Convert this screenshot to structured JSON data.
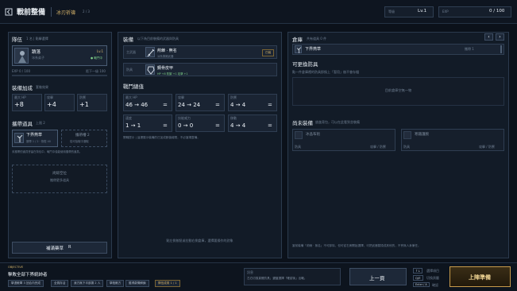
{
  "topbar": {
    "title": "戰前整備",
    "mode": "冰刃祈禱",
    "mode_sub": "2 / 3",
    "level_label": "等級",
    "level_value": "Lv.1",
    "exp_label": "EXP",
    "exp_value": "0 / 100"
  },
  "squad": {
    "title": "隊伍",
    "title_sub": "1 名 | 點擊選擇",
    "member_name": "蹟落",
    "member_class": "冰系弟子",
    "member_level": "Lv.1",
    "member_status": "● 戰鬥中",
    "exp_text": "EXP 0 / 100",
    "exp_next": "距下一級 100",
    "bonus_title": "裝備加成",
    "bonus_sub": "套裝效果",
    "stats": [
      {
        "label": "最大 HP",
        "value": "+8"
      },
      {
        "label": "攻擊",
        "value": "+4"
      },
      {
        "label": "防禦",
        "value": "+1"
      }
    ],
    "carry_title": "攜帶道具",
    "carry_sub": "上限 2",
    "slot1_name": "下界燕草",
    "slot1_meta": "攜帶 1 / 2 · 恢復 40",
    "slot2_name": "攜帶槽 2",
    "slot2_meta": "從可拾取中選取",
    "carry_hint": "未攜帶的道具會留在背包中，戰鬥中僅能使用攜帶的道具。",
    "empty_slot_title": "尚餘空位",
    "empty_slot_sub": "攜帶更多道具",
    "supply_button": "補滿藥草",
    "supply_key": "R"
  },
  "equip": {
    "title": "裝備",
    "title_sub": "以下為目前裝備的武器與防具",
    "weapon_label": "主武器",
    "weapon_name": "荊棘 · 無名",
    "weapon_desc": "冰系專屬武器",
    "weapon_tag": "已裝",
    "armor_label": "防具",
    "armor_name": "鋼骨皮甲",
    "armor_desc": "HP +8   防禦 +1   攻擊 +1",
    "battle_title": "戰鬥總值",
    "battle_stats": [
      {
        "label": "最大 HP",
        "value": "46 → 46"
      },
      {
        "label": "攻擊",
        "value": "24 → 24"
      },
      {
        "label": "防禦",
        "value": "4 → 4"
      },
      {
        "label": "速度",
        "value": "1 → 1"
      },
      {
        "label": "技能威力",
        "value": "0 → 0"
      },
      {
        "label": "移動",
        "value": "4 → 4"
      }
    ],
    "equal_sign": "=",
    "tip": "實戰提示 | 這裡展示裝備的已加成數值總覽，不必當場整備。",
    "footer_hint": "點左側按鈕或拉動右側倉庫，選擇要操作的對象"
  },
  "storage": {
    "title": "倉庫",
    "title_sub": "共有道具 0 件",
    "item_name": "下界燕草",
    "item_meta": "攜帶 1",
    "pickup_title": "可更換防具",
    "pickup_sub": "點一件倉庫裡的防具即換上「暫用」後不會存檔",
    "pickup_empty": "目前倉庫空無一物",
    "unequip_title": "尚未裝備",
    "unequip_sub": "放進背包，可以在此看到並裝備",
    "unequip_items": [
      {
        "name": "冰晶布袍",
        "meta": "防具"
      },
      {
        "name": "寒鐵護腕",
        "meta": "防具"
      }
    ],
    "unequip_meta_right": "攻擊 / 防禦",
    "bottom_hint": "當前裝備「荊棘 · 無名」不可卸除，但可從右側開始選擇，可把武器替換成其他的，不會無人身兼任。"
  },
  "bottom": {
    "objective_label": "OBJECTIVE",
    "objective_text": "擊敗全部下界統帥者",
    "chips": [
      "擊退敵軍 3 回合內完成",
      "全員存活",
      "我方無下半部損 2 人",
      "擊殺敵方",
      "獲得劇情解鎖"
    ],
    "chip_progress": "隊伍成員 1 / 1",
    "message_label": "訊息",
    "message_text": "左右切換頁籤防具；鍵盤選擇「確認後」出戰。",
    "prev_button": "上一頁",
    "key1": "↑↓",
    "key1_label": "選擇項目",
    "key2": "Q/E",
    "key2_label": "切換頁籤",
    "key3": "Enter / A",
    "key3_label": "確認",
    "deploy_button": "上陣準備"
  }
}
